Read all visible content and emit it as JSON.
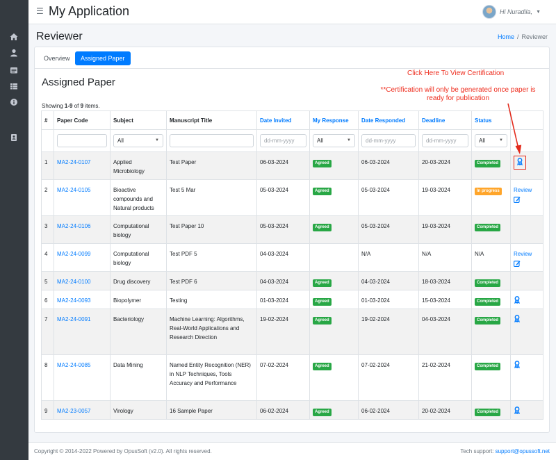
{
  "header": {
    "app_title": "My Application",
    "user_greeting": "Hi Nuradila,"
  },
  "page": {
    "title": "Reviewer",
    "breadcrumb": {
      "home": "Home",
      "current": "Reviewer"
    }
  },
  "tabs": [
    {
      "label": "Overview",
      "active": false
    },
    {
      "label": "Assigned Paper",
      "active": true
    }
  ],
  "annotations": {
    "click_here": "Click Here To View Certification",
    "note": "**Certification will only be generated once paper is ready for publication"
  },
  "section": {
    "title": "Assigned Paper",
    "summary": {
      "prefix": "Showing ",
      "range": "1-9",
      "of": " of ",
      "total": "9",
      "suffix": " items."
    }
  },
  "table": {
    "headers": [
      "#",
      "Paper Code",
      "Subject",
      "Manuscript Title",
      "Date Invited",
      "My Response",
      "Date Responded",
      "Deadline",
      "Status",
      ""
    ],
    "filters": {
      "subject_select": "All",
      "date_invited_placeholder": "dd-mm-yyyy",
      "response_select": "All",
      "date_responded_placeholder": "dd-mm-yyyy",
      "deadline_placeholder": "dd-mm-yyyy",
      "status_select": "All"
    },
    "rows": [
      {
        "no": "1",
        "code": "MA2-24-0107",
        "subject": "Applied Microbiology",
        "title": "Test Paper",
        "date_invited": "06-03-2024",
        "response": "Agreed",
        "date_responded": "06-03-2024",
        "deadline": "20-03-2024",
        "status": "Completed",
        "action": "certificate",
        "highlight": true
      },
      {
        "no": "2",
        "code": "MA2-24-0105",
        "subject": "Bioactive compounds and Natural products",
        "title": "Test 5 Mar",
        "date_invited": "05-03-2024",
        "response": "Agreed",
        "date_responded": "05-03-2024",
        "deadline": "19-03-2024",
        "status": "In progress",
        "action": "review"
      },
      {
        "no": "3",
        "code": "MA2-24-0106",
        "subject": "Computational biology",
        "title": "Test Paper 10",
        "date_invited": "05-03-2024",
        "response": "Agreed",
        "date_responded": "05-03-2024",
        "deadline": "19-03-2024",
        "status": "Completed",
        "action": ""
      },
      {
        "no": "4",
        "code": "MA2-24-0099",
        "subject": "Computational biology",
        "title": "Test PDF 5",
        "date_invited": "04-03-2024",
        "response": "",
        "date_responded": "N/A",
        "deadline": "N/A",
        "status": "N/A",
        "action": "review"
      },
      {
        "no": "5",
        "code": "MA2-24-0100",
        "subject": "Drug discovery",
        "title": "Test PDF 6",
        "date_invited": "04-03-2024",
        "response": "Agreed",
        "date_responded": "04-03-2024",
        "deadline": "18-03-2024",
        "status": "Completed",
        "action": ""
      },
      {
        "no": "6",
        "code": "MA2-24-0093",
        "subject": "Biopolymer",
        "title": "Testing",
        "date_invited": "01-03-2024",
        "response": "Agreed",
        "date_responded": "01-03-2024",
        "deadline": "15-03-2024",
        "status": "Completed",
        "action": "certificate"
      },
      {
        "no": "7",
        "code": "MA2-24-0091",
        "subject": "Bacteriology",
        "title": "Machine Learning: Algorithms, Real-World Applications and Research Direction",
        "date_invited": "19-02-2024",
        "response": "Agreed",
        "date_responded": "19-02-2024",
        "deadline": "04-03-2024",
        "status": "Completed",
        "action": "certificate"
      },
      {
        "no": "8",
        "code": "MA2-24-0085",
        "subject": "Data Mining",
        "title": "Named Entity Recognition (NER) in NLP Techniques, Tools Accuracy and Performance",
        "date_invited": "07-02-2024",
        "response": "Agreed",
        "date_responded": "07-02-2024",
        "deadline": "21-02-2024",
        "status": "Completed",
        "action": "certificate"
      },
      {
        "no": "9",
        "code": "MA2-23-0057",
        "subject": "Virology",
        "title": "16 Sample Paper",
        "date_invited": "06-02-2024",
        "response": "Agreed",
        "date_responded": "06-02-2024",
        "deadline": "20-02-2024",
        "status": "Completed",
        "action": "certificate"
      }
    ],
    "review_label": "Review"
  },
  "footer": {
    "copyright": "Copyright © 2014-2022 Powered by OpusSoft (v2.0). All rights reserved.",
    "support_label": "Tech support: ",
    "support_email": "support@opussoft.net"
  },
  "colors": {
    "primary": "#007bff",
    "sidebar": "#343a40",
    "success": "#28a745",
    "warning": "#ffa52a",
    "annotation": "#ee2b1c"
  },
  "icons": {
    "sidebar": [
      "home-icon",
      "user-icon",
      "list-icon",
      "table-icon",
      "info-icon",
      "id-card-icon"
    ],
    "row_certificate": "certificate-icon",
    "row_review": "edit-icon"
  }
}
